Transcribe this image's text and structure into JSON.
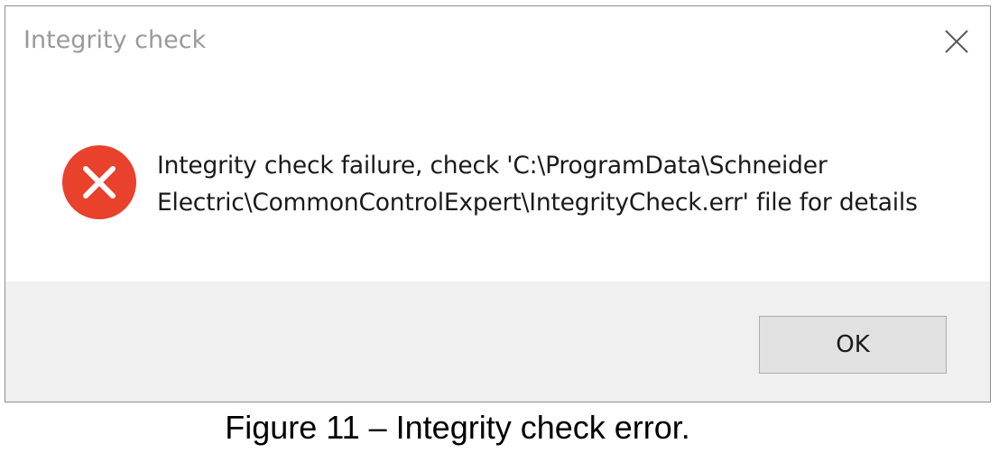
{
  "dialog": {
    "title": "Integrity check",
    "close_icon": "close-icon",
    "error_icon": "error-icon",
    "message_lines": [
      "Integrity check failure, check 'C:\\ProgramData\\Schneider",
      "Electric\\CommonControlExpert\\IntegrityCheck.err' file for details"
    ],
    "ok_label": "OK"
  },
  "caption": "Figure 11 – Integrity check error.",
  "colors": {
    "error_red": "#e8412c",
    "footer_bg": "#f0f0f0",
    "button_bg": "#e1e1e1",
    "title_text": "#9a9a9a"
  }
}
